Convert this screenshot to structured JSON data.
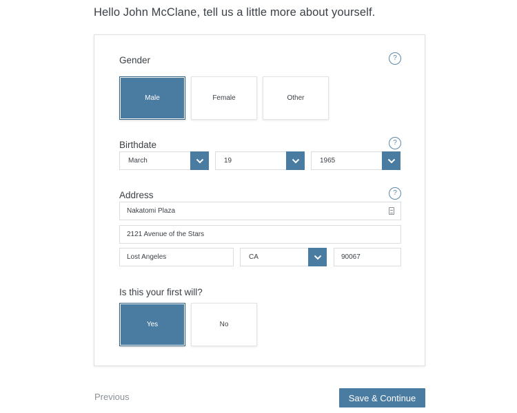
{
  "greeting": "Hello John McClane, tell us a little more about yourself.",
  "help_glyph": "?",
  "gender": {
    "title": "Gender",
    "options": [
      "Male",
      "Female",
      "Other"
    ],
    "selected": "Male"
  },
  "birthdate": {
    "title": "Birthdate",
    "month": "March",
    "day": "19",
    "year": "1965"
  },
  "address": {
    "title": "Address",
    "line1": "Nakatomi Plaza",
    "line2": "2121 Avenue of the Stars",
    "city": "Lost Angeles",
    "state": "CA",
    "zip": "90067"
  },
  "first_will": {
    "title": "Is this your first will?",
    "options": [
      "Yes",
      "No"
    ],
    "selected": "Yes"
  },
  "footer": {
    "previous_label": "Previous",
    "save_label": "Save & Continue"
  },
  "colors": {
    "accent": "#4a7ba0",
    "accent_border": "#2f5d80",
    "text": "#3a3f45",
    "muted": "#8a9096"
  },
  "icons": {
    "help": "question-circle-icon",
    "dropdown": "chevron-down-icon",
    "autofill": "contact-card-icon"
  }
}
